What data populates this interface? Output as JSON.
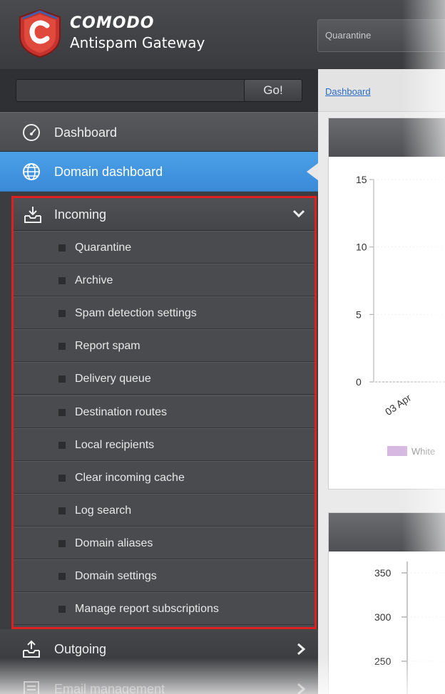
{
  "header": {
    "brand_top": "COMODO",
    "brand_bottom": "Antispam Gateway",
    "top_tab": "Quarantine"
  },
  "search": {
    "value": "",
    "go_label": "Go!"
  },
  "sidebar": {
    "dashboard": "Dashboard",
    "domain_dashboard": "Domain dashboard",
    "incoming": "Incoming",
    "incoming_items": [
      "Quarantine",
      "Archive",
      "Spam detection settings",
      "Report spam",
      "Delivery queue",
      "Destination routes",
      "Local recipients",
      "Clear incoming cache",
      "Log search",
      "Domain aliases",
      "Domain settings",
      "Manage report subscriptions"
    ],
    "outgoing": "Outgoing",
    "email_management": "Email management"
  },
  "main": {
    "breadcrumb": "Dashboard"
  },
  "chart_data": [
    {
      "type": "bar",
      "yticks": [
        "15",
        "10",
        "5",
        "0"
      ],
      "ylim": [
        0,
        15
      ],
      "categories": [
        "03 Apr"
      ],
      "legend": [
        "White"
      ]
    },
    {
      "type": "line",
      "yticks": [
        "350",
        "300",
        "250"
      ]
    }
  ],
  "colors": {
    "sidebar_bg": "#3c3d40",
    "active_blue": "#3f93de",
    "highlight_red": "#e02020",
    "legend_purple": "#d6b8e0"
  }
}
